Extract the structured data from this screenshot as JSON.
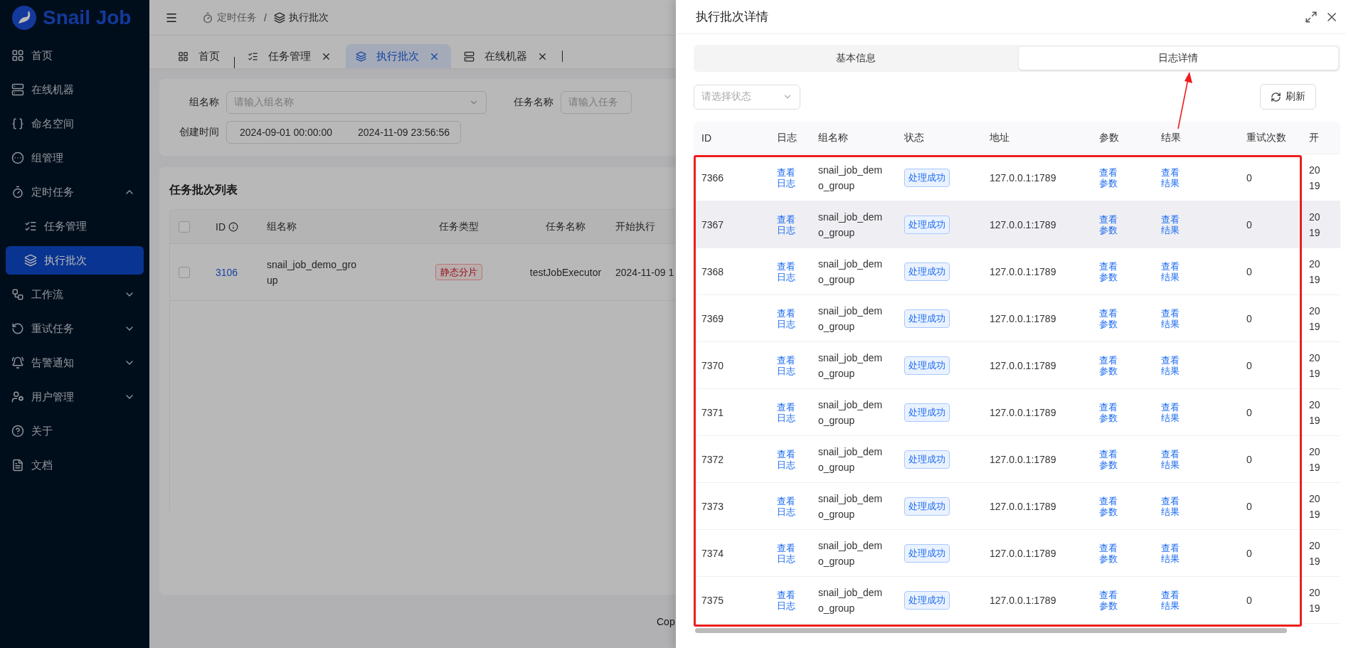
{
  "sidebar": {
    "logo": "Snail Job",
    "items": [
      {
        "label": "首页",
        "selected": false
      },
      {
        "label": "在线机器",
        "selected": false
      },
      {
        "label": "命名空间",
        "selected": false
      },
      {
        "label": "组管理",
        "selected": false
      },
      {
        "label": "定时任务",
        "selected": false,
        "expanded": true,
        "children": [
          {
            "label": "任务管理",
            "selected": false
          },
          {
            "label": "执行批次",
            "selected": true
          }
        ]
      },
      {
        "label": "工作流",
        "selected": false,
        "expanded": false
      },
      {
        "label": "重试任务",
        "selected": false,
        "expanded": false
      },
      {
        "label": "告警通知",
        "selected": false,
        "expanded": false
      },
      {
        "label": "用户管理",
        "selected": false,
        "expanded": false
      },
      {
        "label": "关于",
        "selected": false
      },
      {
        "label": "文档",
        "selected": false
      }
    ]
  },
  "breadcrumb": {
    "items": [
      "定时任务",
      "执行批次"
    ],
    "separator": "/"
  },
  "tabs": [
    {
      "label": "首页",
      "selected": false,
      "closable": false
    },
    {
      "label": "任务管理",
      "selected": false,
      "closable": true
    },
    {
      "label": "执行批次",
      "selected": true,
      "closable": true
    },
    {
      "label": "在线机器",
      "selected": false,
      "closable": true
    }
  ],
  "search": {
    "fields": [
      {
        "label": "组名称",
        "placeholder": "请输入组名称",
        "kind": "select"
      },
      {
        "label": "任务名称",
        "placeholder": "请输入任务",
        "kind": "input"
      }
    ],
    "date_range": {
      "label": "创建时间",
      "start": "2024-09-01 00:00:00",
      "end": "2024-11-09 23:56:56"
    }
  },
  "batch_list": {
    "title": "任务批次列表",
    "select_all_checked": false,
    "columns": [
      "ID",
      "组名称",
      "任务类型",
      "任务名称",
      "开始执行"
    ],
    "rows": [
      {
        "checked": false,
        "id": "3106",
        "group": "snail_job_demo_group",
        "type": "静态分片",
        "task": "testJobExecutor",
        "start": "2024-11-09 1"
      }
    ]
  },
  "footer": "Cop",
  "drawer": {
    "title": "执行批次详情",
    "tabs": [
      {
        "label": "基本信息",
        "selected": false
      },
      {
        "label": "日志详情",
        "selected": true
      }
    ],
    "status_select": {
      "placeholder": "请选择状态"
    },
    "refresh_button": "刷新",
    "table": {
      "columns": [
        "ID",
        "日志",
        "组名称",
        "状态",
        "地址",
        "参数",
        "结果",
        "重试次数",
        "开"
      ],
      "rows": [
        {
          "id": "7366",
          "log": "查看日志",
          "group": "snail_job_demo_group",
          "status": "处理成功",
          "address": "127.0.0.1:1789",
          "params": "查看参数",
          "result": "查看结果",
          "retries": "0",
          "column_9": [
            "20",
            "19"
          ]
        },
        {
          "id": "7367",
          "log": "查看日志",
          "group": "snail_job_demo_group",
          "status": "处理成功",
          "address": "127.0.0.1:1789",
          "params": "查看参数",
          "result": "查看结果",
          "retries": "0",
          "column_9": [
            "20",
            "19"
          ],
          "hovered": true
        },
        {
          "id": "7368",
          "log": "查看日志",
          "group": "snail_job_demo_group",
          "status": "处理成功",
          "address": "127.0.0.1:1789",
          "params": "查看参数",
          "result": "查看结果",
          "retries": "0",
          "column_9": [
            "20",
            "19"
          ]
        },
        {
          "id": "7369",
          "log": "查看日志",
          "group": "snail_job_demo_group",
          "status": "处理成功",
          "address": "127.0.0.1:1789",
          "params": "查看参数",
          "result": "查看结果",
          "retries": "0",
          "column_9": [
            "20",
            "19"
          ]
        },
        {
          "id": "7370",
          "log": "查看日志",
          "group": "snail_job_demo_group",
          "status": "处理成功",
          "address": "127.0.0.1:1789",
          "params": "查看参数",
          "result": "查看结果",
          "retries": "0",
          "column_9": [
            "20",
            "19"
          ]
        },
        {
          "id": "7371",
          "log": "查看日志",
          "group": "snail_job_demo_group",
          "status": "处理成功",
          "address": "127.0.0.1:1789",
          "params": "查看参数",
          "result": "查看结果",
          "retries": "0",
          "column_9": [
            "20",
            "19"
          ]
        },
        {
          "id": "7372",
          "log": "查看日志",
          "group": "snail_job_demo_group",
          "status": "处理成功",
          "address": "127.0.0.1:1789",
          "params": "查看参数",
          "result": "查看结果",
          "retries": "0",
          "column_9": [
            "20",
            "19"
          ]
        },
        {
          "id": "7373",
          "log": "查看日志",
          "group": "snail_job_demo_group",
          "status": "处理成功",
          "address": "127.0.0.1:1789",
          "params": "查看参数",
          "result": "查看结果",
          "retries": "0",
          "column_9": [
            "20",
            "19"
          ]
        },
        {
          "id": "7374",
          "log": "查看日志",
          "group": "snail_job_demo_group",
          "status": "处理成功",
          "address": "127.0.0.1:1789",
          "params": "查看参数",
          "result": "查看结果",
          "retries": "0",
          "column_9": [
            "20",
            "19"
          ]
        },
        {
          "id": "7375",
          "log": "查看日志",
          "group": "snail_job_demo_group",
          "status": "处理成功",
          "address": "127.0.0.1:1789",
          "params": "查看参数",
          "result": "查看结果",
          "retries": "0",
          "column_9": [
            "20",
            "19"
          ]
        }
      ]
    }
  }
}
